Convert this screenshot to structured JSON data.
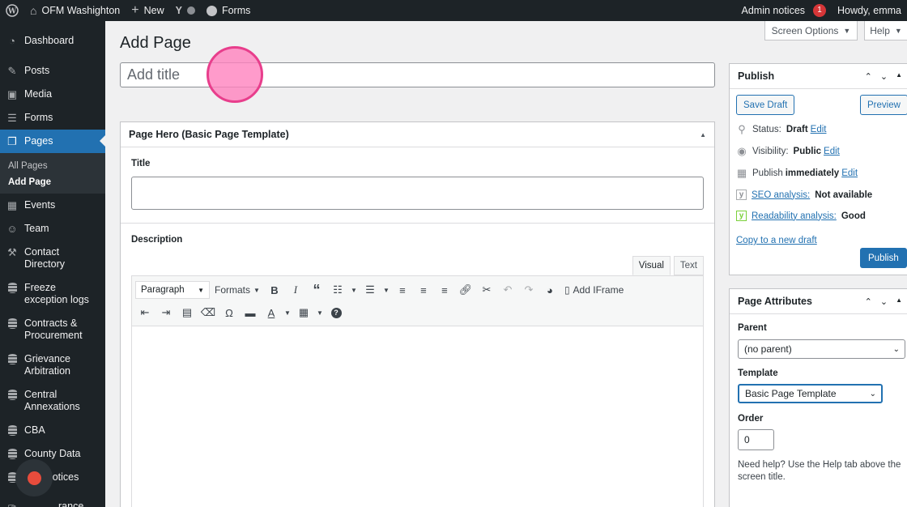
{
  "admin_bar": {
    "site_name": "OFM Washighton",
    "new_label": "New",
    "forms_label": "Forms",
    "admin_notices_label": "Admin notices",
    "admin_notices_count": "1",
    "howdy": "Howdy, emma"
  },
  "sidebar": {
    "items": [
      {
        "label": "Dashboard",
        "icon": "dashboard-icon"
      },
      {
        "label": "Posts",
        "icon": "pin-icon"
      },
      {
        "label": "Media",
        "icon": "media-icon"
      },
      {
        "label": "Forms",
        "icon": "forms-icon"
      },
      {
        "label": "Pages",
        "icon": "pages-icon"
      },
      {
        "label": "Events",
        "icon": "calendar-icon"
      },
      {
        "label": "Team",
        "icon": "team-icon"
      },
      {
        "label": "Contact Directory",
        "icon": "wrench-icon"
      },
      {
        "label": "Freeze exception logs",
        "icon": "database-icon"
      },
      {
        "label": "Contracts & Procurement",
        "icon": "database-icon"
      },
      {
        "label": "Grievance Arbitration",
        "icon": "database-icon"
      },
      {
        "label": "Central Annexations",
        "icon": "database-icon"
      },
      {
        "label": "CBA",
        "icon": "database-icon"
      },
      {
        "label": "County Data",
        "icon": "database-icon"
      },
      {
        "label": "EJA Notices",
        "icon": "database-icon"
      },
      {
        "label": "rance",
        "icon": "tool-icon"
      }
    ],
    "submenu": [
      "All Pages",
      "Add Page"
    ]
  },
  "screen_options_label": "Screen Options",
  "help_label": "Help",
  "page_title": "Add Page",
  "title_placeholder": "Add title",
  "hero_box": {
    "heading": "Page Hero (Basic Page Template)",
    "title_label": "Title",
    "description_label": "Description",
    "tab_visual": "Visual",
    "tab_text": "Text",
    "paragraph_select": "Paragraph",
    "formats_label": "Formats",
    "add_iframe_label": "Add IFrame"
  },
  "publish_box": {
    "heading": "Publish",
    "save_draft": "Save Draft",
    "preview": "Preview",
    "status_label": "Status:",
    "status_value": "Draft",
    "visibility_label": "Visibility:",
    "visibility_value": "Public",
    "publish_label": "Publish",
    "publish_value": "immediately",
    "edit": "Edit",
    "seo_label": "SEO analysis:",
    "seo_value": "Not available",
    "readability_label": "Readability analysis:",
    "readability_value": "Good",
    "copy_draft": "Copy to a new draft",
    "publish_button": "Publish"
  },
  "attributes_box": {
    "heading": "Page Attributes",
    "parent_label": "Parent",
    "parent_value": "(no parent)",
    "template_label": "Template",
    "template_value": "Basic Page Template",
    "order_label": "Order",
    "order_value": "0",
    "help_text": "Need help? Use the Help tab above the screen title."
  },
  "colors": {
    "accent": "#2271b1",
    "admin_dark": "#1d2327",
    "notice_badge": "#d63638",
    "click_indicator": "#ff82be",
    "record": "#e74c3c"
  }
}
